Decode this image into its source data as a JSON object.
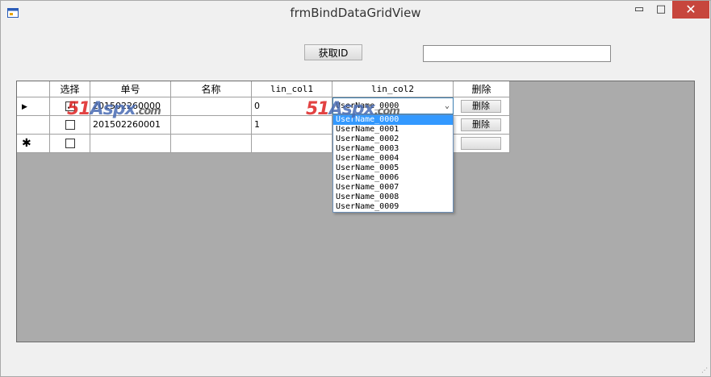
{
  "window": {
    "title": "frmBindDataGridView",
    "minimize_glyph": "▭",
    "maximize_glyph": "□",
    "close_glyph": "✕",
    "app_icon": "form-icon"
  },
  "toolbar": {
    "getid_label": "获取ID",
    "id_value": ""
  },
  "grid": {
    "headers": {
      "select": "选择",
      "order_no": "单号",
      "name": "名称",
      "col1": "lin_col1",
      "col2": "lin_col2",
      "delete": "删除"
    },
    "rows": [
      {
        "marker": "▶",
        "checked": true,
        "check_glyph": "✓",
        "order_no": "201502260000",
        "name": "",
        "col1": "0",
        "col2": "UserName_0000",
        "delete_label": "删除"
      },
      {
        "marker": "",
        "checked": false,
        "check_glyph": "",
        "order_no": "201502260001",
        "name": "",
        "col1": "1",
        "col2": "",
        "delete_label": "删除"
      },
      {
        "marker": "✱",
        "checked": false,
        "check_glyph": "",
        "order_no": "",
        "name": "",
        "col1": "",
        "col2": "",
        "delete_label": ""
      }
    ],
    "combo_arrow": "⌄",
    "dropdown_options": [
      "UserName_0000",
      "UserName_0001",
      "UserName_0002",
      "UserName_0003",
      "UserName_0004",
      "UserName_0005",
      "UserName_0006",
      "UserName_0007",
      "UserName_0008",
      "UserName_0009"
    ],
    "selected_option_index": 0
  },
  "watermarks": [
    {
      "a": "51",
      "b": "Aspx",
      "c": ".com"
    },
    {
      "a": "51",
      "b": "Aspx",
      "c": ".com"
    }
  ],
  "resize_grip": "⋰"
}
